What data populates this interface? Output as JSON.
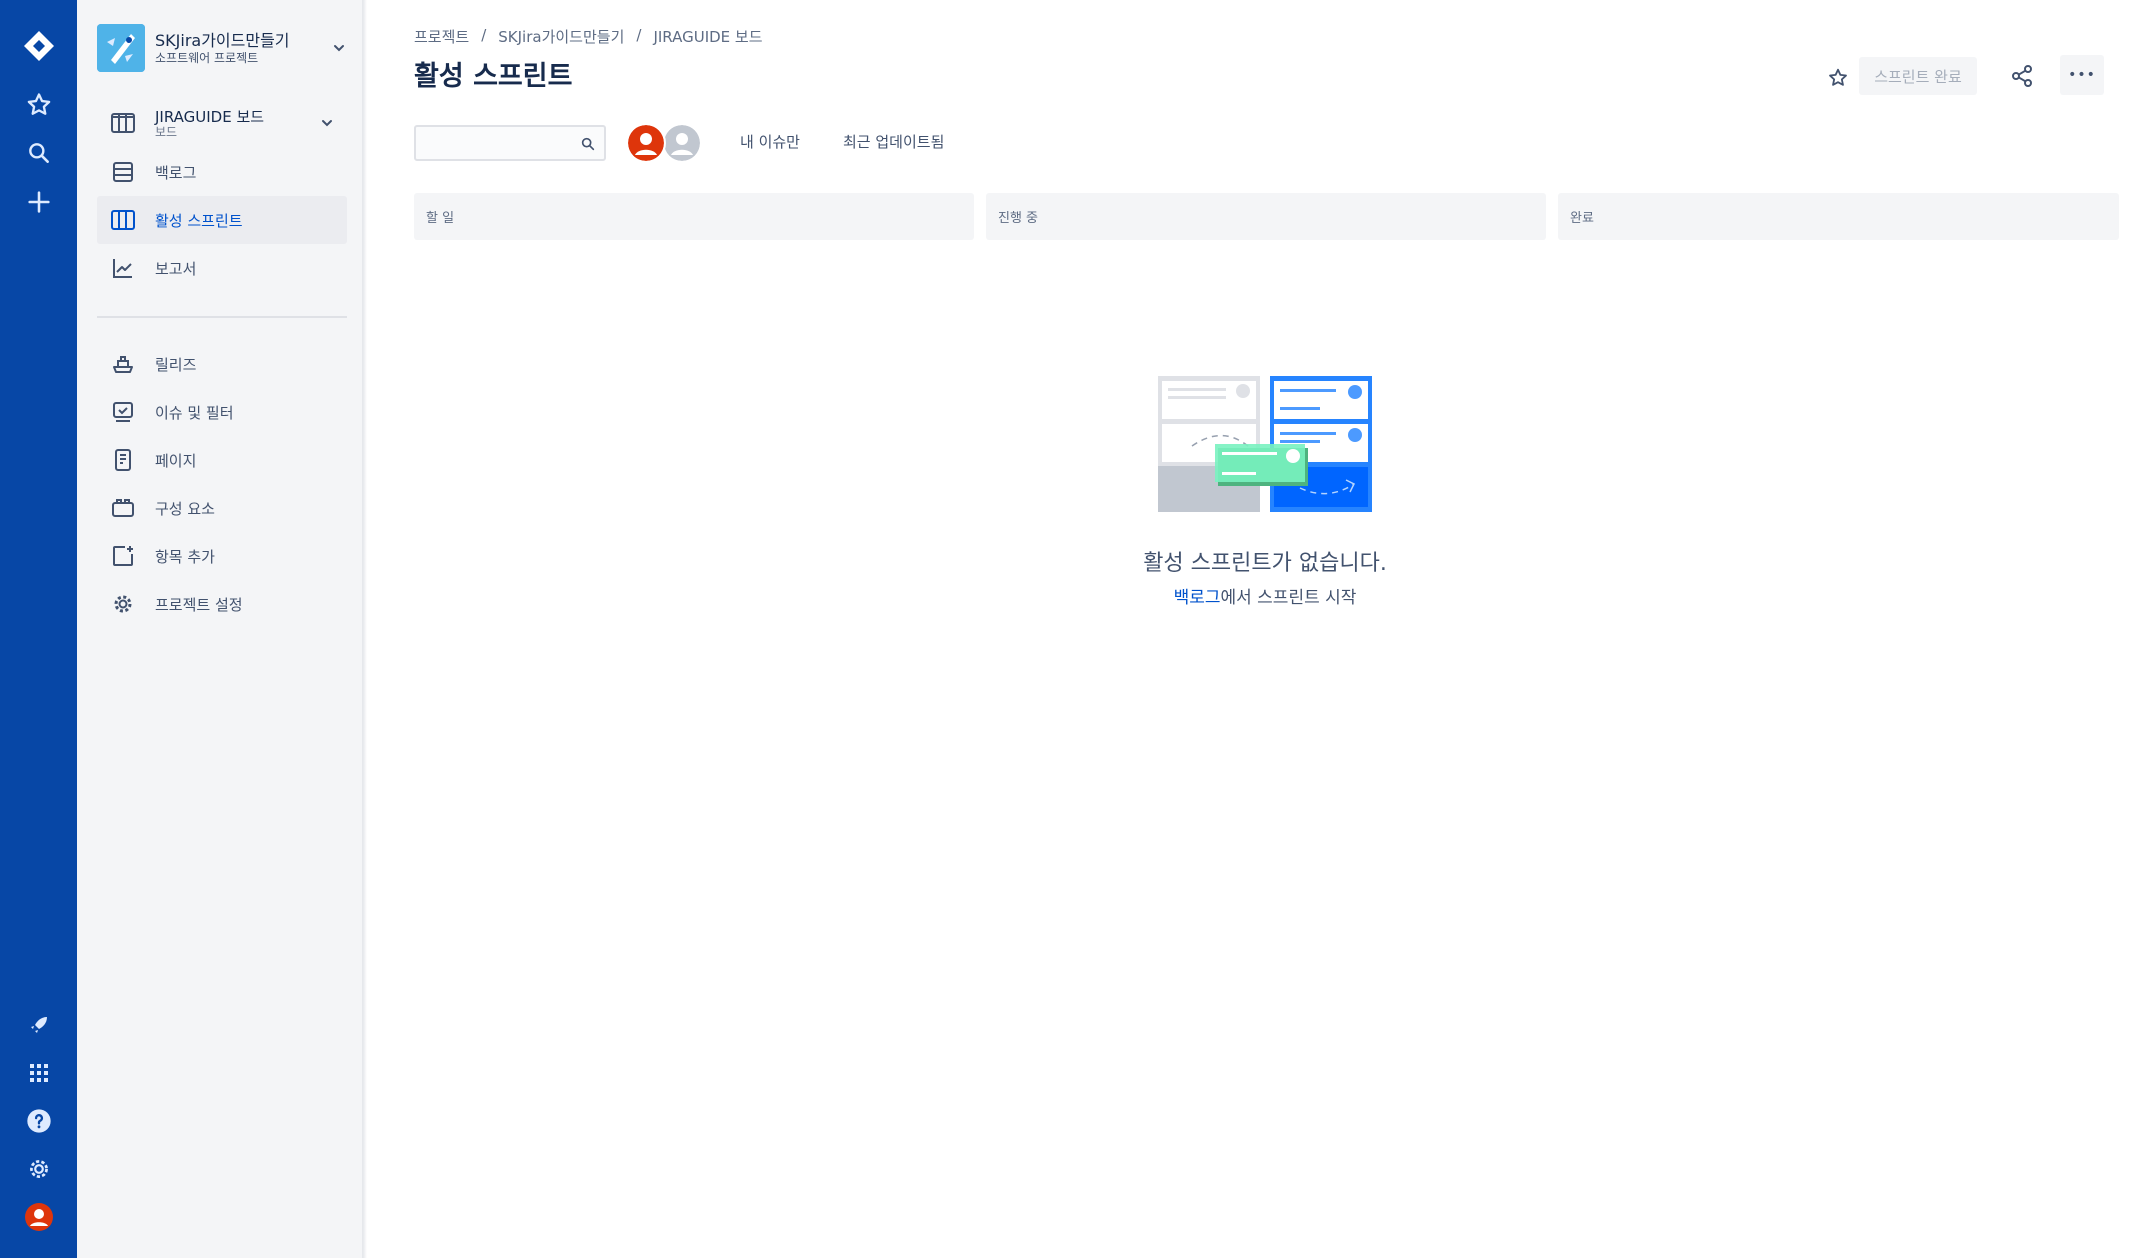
{
  "global_nav": {
    "icons": [
      "jira-logo-icon",
      "star-icon",
      "search-icon",
      "plus-icon",
      "rocket-icon",
      "app-switcher-icon",
      "help-icon",
      "settings-icon",
      "profile-icon"
    ]
  },
  "sidebar": {
    "project_name": "SKJira가이드만들기",
    "project_type": "소프트웨어 프로젝트",
    "board_name": "JIRAGUIDE 보드",
    "board_sub": "보드",
    "items": [
      {
        "label": "백로그",
        "icon": "backlog-icon"
      },
      {
        "label": "활성 스프린트",
        "icon": "board-columns-icon",
        "active": true
      },
      {
        "label": "보고서",
        "icon": "reports-chart-icon"
      },
      {
        "label": "릴리즈",
        "icon": "ship-icon"
      },
      {
        "label": "이슈 및 필터",
        "icon": "issues-icon"
      },
      {
        "label": "페이지",
        "icon": "page-icon"
      },
      {
        "label": "구성 요소",
        "icon": "component-icon"
      },
      {
        "label": "항목 추가",
        "icon": "add-item-icon"
      },
      {
        "label": "프로젝트 설정",
        "icon": "gear-icon"
      }
    ]
  },
  "breadcrumb": [
    "프로젝트",
    "SKJira가이드만들기",
    "JIRAGUIDE 보드"
  ],
  "breadcrumb_sep": "/",
  "page_title": "활성 스프린트",
  "header": {
    "complete_sprint": "스프린트 완료",
    "more": "•••"
  },
  "filters": {
    "search_placeholder": "",
    "quick_filters": [
      "내 이슈만",
      "최근 업데이트됨"
    ]
  },
  "columns": [
    "할 일",
    "진행 중",
    "완료"
  ],
  "empty_state": {
    "title": "활성 스프린트가 없습니다.",
    "link": "백로그",
    "rest": "에서 스프린트 시작"
  },
  "colors": {
    "global_nav": "#0747a6",
    "accent": "#0052cc",
    "sidebar_bg": "#f4f5f7",
    "avatar_red": "#de350b"
  }
}
